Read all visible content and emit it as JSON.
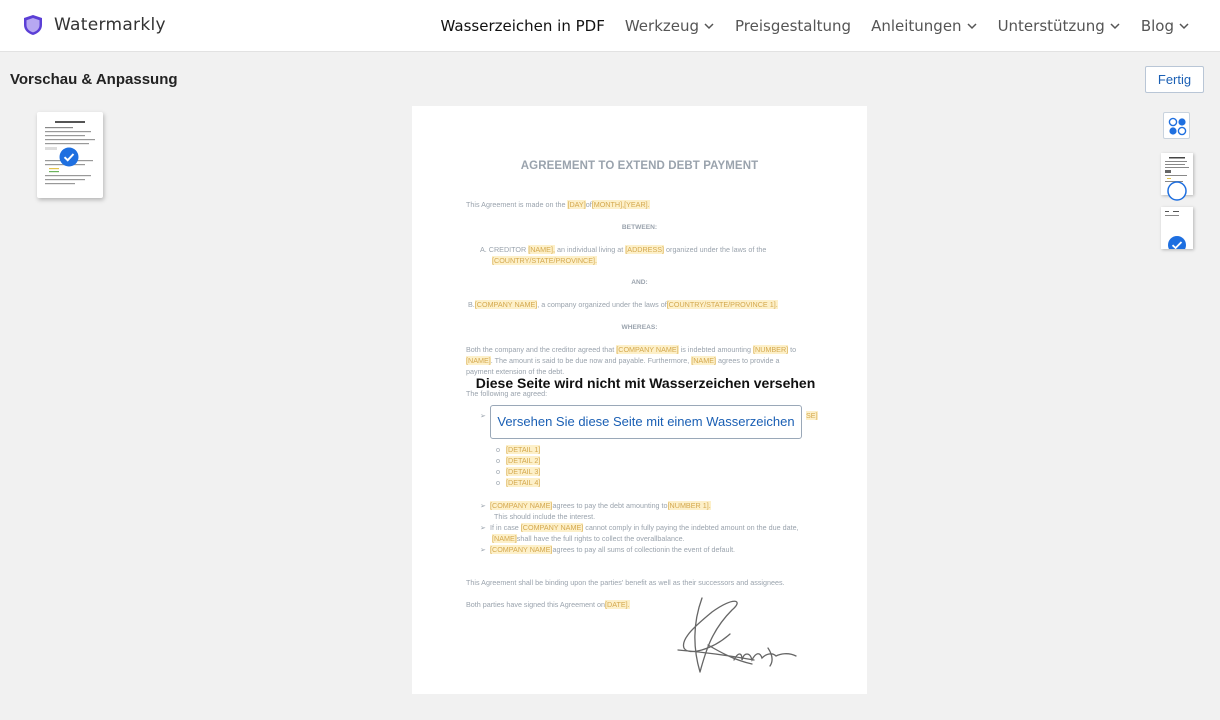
{
  "header": {
    "brand": "Watermarkly",
    "nav": [
      {
        "label": "Wasserzeichen in PDF",
        "dropdown": false,
        "active": true
      },
      {
        "label": "Werkzeug",
        "dropdown": true
      },
      {
        "label": "Preisgestaltung",
        "dropdown": false
      },
      {
        "label": "Anleitungen",
        "dropdown": true
      },
      {
        "label": "Unterstützung",
        "dropdown": true
      },
      {
        "label": "Blog",
        "dropdown": true
      }
    ]
  },
  "toolbar": {
    "section_title": "Vorschau & Anpassung",
    "done_label": "Fertig"
  },
  "document": {
    "title": "AGREEMENT TO EXTEND DEBT PAYMENT",
    "made_on": "This Agreement is made on the",
    "day": "[DAY]",
    "of": "of",
    "month_year": "[MONTH],[YEAR].",
    "between": "BETWEEN:",
    "a_prefix": "A.   CREDITOR",
    "name": "[NAME],",
    "individual": "an individual        living at",
    "address": "[ADDRESS]",
    "organized": "organized under     the  laws of     the",
    "country": "[COUNTRY/STATE/PROVINCE].",
    "and": "AND:",
    "b_prefix": "B.",
    "company_name": "[COMPANY NAME]",
    "company_org": ", a company organized under the laws of",
    "country1": "[COUNTRY/STATE/PROVINCE 1].",
    "whereas": "WHEREAS:",
    "both_1": "Both the company and the creditor agreed that",
    "indebted": "is indebted amounting",
    "number": "[NUMBER]",
    "to": "to",
    "name_plain": "[NAME]",
    "due_now": ". The amount is said to be due now and payable. Furthermore,",
    "agrees_provide": "agrees to provide a",
    "payment_ext": "payment extension of the debt.",
    "following": "The following are agreed:",
    "bracket_se": "SE]",
    "details": [
      "[DETAIL 1]",
      "[DETAIL 2]",
      "[DETAIL 3]",
      "[DETAIL 4]"
    ],
    "agrees_pay": "agrees to pay the debt amounting to",
    "number1": "[NUMBER 1].",
    "include_interest": "This should include the interest.",
    "if_case": "If in case",
    "cannot_comply": "cannot comply in fully paying the indebted amount on the due date,",
    "full_rights": "shall have the full rights to collect the overallbalance.",
    "agrees_all": "agrees to pay all sums of collectionin the event of default.",
    "binding": "This Agreement shall be binding upon the parties' benefit as well as their successors and assignees.",
    "signed": "Both parties have signed this Agreement on",
    "date": "[DATE]."
  },
  "overlay": {
    "message": "Diese Seite wird nicht mit Wasserzeichen versehen",
    "button": "Versehen Sie diese Seite mit einem Wasserzeichen"
  },
  "colors": {
    "accent": "#1a5fb4",
    "check": "#1e6fe0",
    "brand_shield": "#5b3fd6",
    "placeholder_highlight": "#fdf0c9"
  }
}
